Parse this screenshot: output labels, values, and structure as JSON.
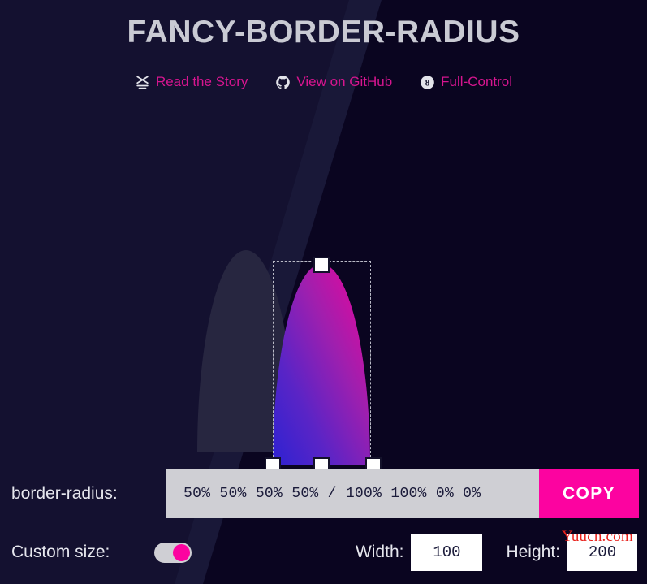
{
  "header": {
    "title": "FANCY-BORDER-RADIUS",
    "links": [
      {
        "label": "Read the Story",
        "icon": "medium-x-icon"
      },
      {
        "label": "View on GitHub",
        "icon": "github-icon"
      },
      {
        "label": "Full-Control",
        "icon": "eight-ball-icon"
      }
    ]
  },
  "editor": {
    "shape_border_radius": "50% 50% 50% 50% / 100% 100% 0% 0%",
    "handles": [
      "handle-top",
      "handle-bottom-left",
      "handle-bottom-middle",
      "handle-bottom-right"
    ]
  },
  "output": {
    "label": "border-radius:",
    "value": "50% 50% 50% 50%  /  100% 100% 0% 0%",
    "copy_label": "COPY"
  },
  "controls": {
    "custom_size_label": "Custom size:",
    "custom_size_on": true,
    "width_label": "Width:",
    "width_value": "100",
    "height_label": "Height:",
    "height_value": "200"
  },
  "watermark": {
    "text": "Yuucn.com"
  },
  "colors": {
    "background": "#0a0520",
    "background_panel": "#191838",
    "accent_pink": "#fc03a0",
    "link_pink": "#d6158f",
    "title_gray": "#c9cad3",
    "shape_gradient_from": "#2d22d2",
    "shape_gradient_to": "#e6079c",
    "watermark_red": "#e8211c"
  }
}
